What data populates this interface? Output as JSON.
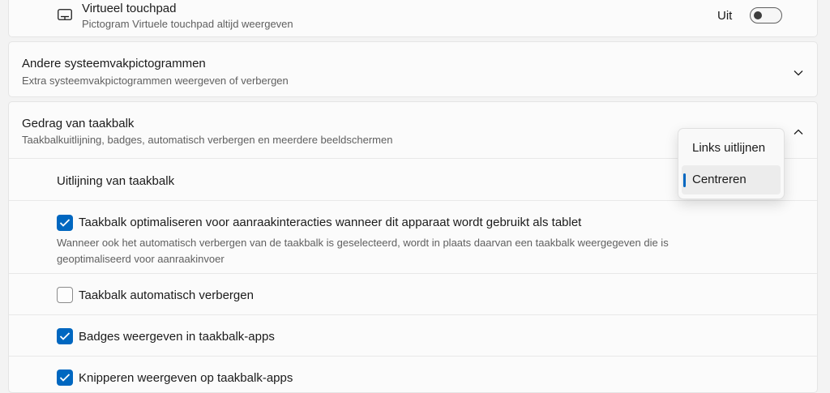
{
  "touchpad": {
    "title": "Virtueel touchpad",
    "subtitle": "Pictogram Virtuele touchpad altijd weergeven",
    "toggle_label": "Uit",
    "toggle_on": false
  },
  "other_icons": {
    "title": "Andere systeemvakpictogrammen",
    "subtitle": "Extra systeemvakpictogrammen weergeven of verbergen"
  },
  "behavior": {
    "title": "Gedrag van taakbalk",
    "subtitle": "Taakbalkuitlijning, badges, automatisch verbergen en meerdere beeldschermen",
    "alignment_label": "Uitlijning van taakbalk",
    "alignment_options": [
      "Links uitlijnen",
      "Centreren"
    ],
    "alignment_selected": "Centreren",
    "options": [
      {
        "label": "Taakbalk optimaliseren voor aanraakinteracties wanneer dit apparaat wordt gebruikt als tablet",
        "description_line1": "Wanneer ook het automatisch verbergen van de taakbalk is geselecteerd, wordt in plaats daarvan een taakbalk weergegeven die is",
        "description_line2": "geoptimaliseerd voor aanraakinvoer",
        "checked": true
      },
      {
        "label": "Taakbalk automatisch verbergen",
        "checked": false
      },
      {
        "label": "Badges weergeven in taakbalk-apps",
        "checked": true
      },
      {
        "label": "Knipperen weergeven op taakbalk-apps",
        "checked": true
      }
    ]
  },
  "colors": {
    "accent": "#0067c0",
    "card_background": "#fbfbfb",
    "page_background": "#f3f3f3"
  }
}
